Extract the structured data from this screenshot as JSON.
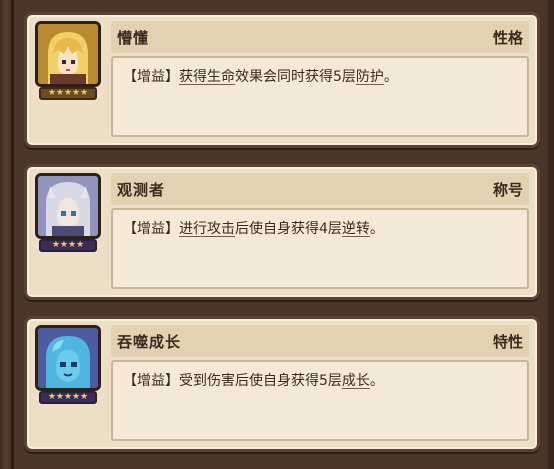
{
  "cards": [
    {
      "name": "懵懂",
      "tag": "性格",
      "desc": {
        "pre": "【增益】",
        "k1": "获得生命",
        "mid": "效果会同时获得5层",
        "k2": "防护",
        "post": "。"
      },
      "stars": "★★★★★",
      "portrait_icon": "blonde-hero-portrait-icon"
    },
    {
      "name": "观测者",
      "tag": "称号",
      "desc": {
        "pre": "【增益】",
        "k1": "进行攻击",
        "mid": "后使自身获得4层",
        "k2": "逆转",
        "post": "。"
      },
      "stars": "★★★★",
      "portrait_icon": "silver-hair-hero-portrait-icon"
    },
    {
      "name": "吞噬成长",
      "tag": "特性",
      "desc": {
        "pre": "【增益】",
        "k1": "",
        "mid": "受到伤害后使自身获得5层",
        "k2": "成长",
        "post": "。"
      },
      "stars": "★★★★★",
      "portrait_icon": "blue-slime-hero-portrait-icon"
    }
  ],
  "colors": {
    "card_bg": "#ecdfc6",
    "border": "#5a4232",
    "text": "#3b2a20",
    "star": "#f2c94c"
  }
}
